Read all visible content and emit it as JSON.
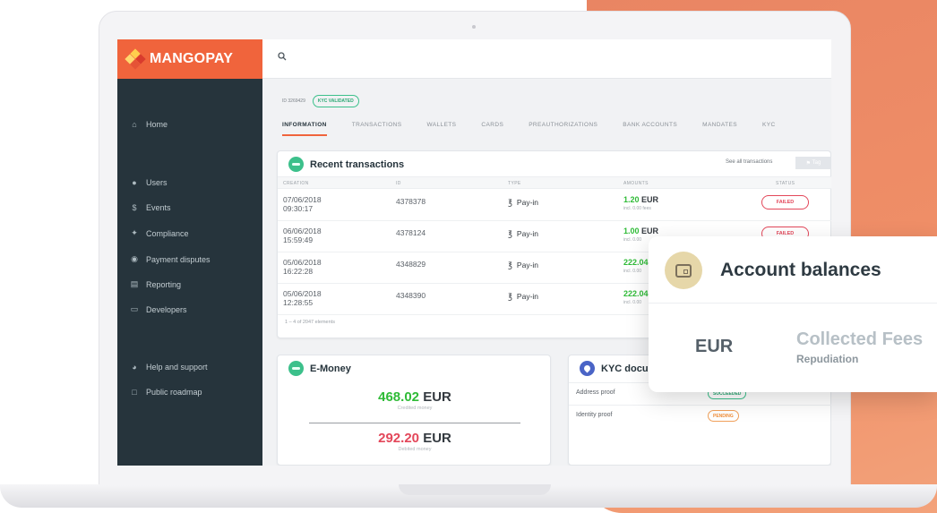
{
  "brand": {
    "name": "MANGOPAY",
    "colors": {
      "orange": "#f0643c",
      "dark": "#26343c",
      "green": "#3cc08b"
    }
  },
  "sidebar": {
    "items": [
      {
        "icon": "home-icon",
        "label": "Home"
      },
      {
        "icon": "users-icon",
        "label": "Users"
      },
      {
        "icon": "dollar-icon",
        "label": "Events"
      },
      {
        "icon": "wrench-icon",
        "label": "Compliance"
      },
      {
        "icon": "alert-icon",
        "label": "Payment disputes"
      },
      {
        "icon": "chart-icon",
        "label": "Reporting"
      },
      {
        "icon": "monitor-icon",
        "label": "Developers"
      },
      {
        "icon": "help-icon",
        "label": "Help and support"
      },
      {
        "icon": "roadmap-icon",
        "label": "Public roadmap"
      }
    ]
  },
  "user": {
    "id_text": "ID 3269429",
    "kyc_badge": "KYC VALIDATED"
  },
  "tabs": [
    "INFORMATION",
    "TRANSACTIONS",
    "WALLETS",
    "CARDS",
    "PREAUTHORIZATIONS",
    "BANK ACCOUNTS",
    "MANDATES",
    "KYC"
  ],
  "recent": {
    "title": "Recent transactions",
    "see_all": "See all transactions",
    "tag_button": "Tag",
    "columns": [
      "CREATION",
      "ID",
      "TYPE",
      "AMOUNTS",
      "STATUS"
    ],
    "rows": [
      {
        "date": "07/06/2018",
        "time": "09:30:17",
        "id": "4378378",
        "type": "Pay-in",
        "amount": "1.20",
        "currency": "EUR",
        "fees": "incl. 0.00 fees",
        "status": "FAILED"
      },
      {
        "date": "06/06/2018",
        "time": "15:59:49",
        "id": "4378124",
        "type": "Pay-in",
        "amount": "1.00",
        "currency": "EUR",
        "fees": "incl. 0.00",
        "status": "FAILED"
      },
      {
        "date": "05/06/2018",
        "time": "16:22:28",
        "id": "4348829",
        "type": "Pay-in",
        "amount": "222.04",
        "currency": "",
        "fees": "incl. 0.00",
        "status": ""
      },
      {
        "date": "05/06/2018",
        "time": "12:28:55",
        "id": "4348390",
        "type": "Pay-in",
        "amount": "222.04",
        "currency": "",
        "fees": "incl. 0.00",
        "status": ""
      }
    ],
    "pager": "1 – 4 of 2047 elements"
  },
  "emoney": {
    "title": "E-Money",
    "credited_value": "468.02",
    "credited_currency": "EUR",
    "credited_label": "Credited money",
    "debited_value": "292.20",
    "debited_currency": "EUR",
    "debited_label": "Debited money"
  },
  "kyc": {
    "title": "KYC docu",
    "rows": [
      {
        "label": "Address proof",
        "status": "SUCCEEDED"
      },
      {
        "label": "Identity proof",
        "status": "PENDING"
      }
    ]
  },
  "balances": {
    "title": "Account balances",
    "currency": "EUR",
    "fees_label": "Collected Fees",
    "fees_sub": "Repudiation"
  }
}
